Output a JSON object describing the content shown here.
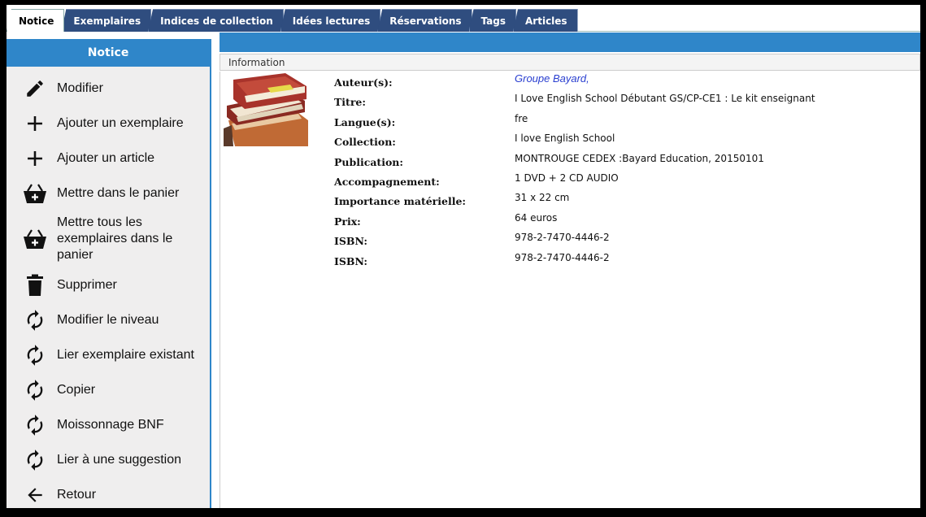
{
  "tabs": [
    {
      "label": "Notice",
      "active": true
    },
    {
      "label": "Exemplaires"
    },
    {
      "label": "Indices de collection"
    },
    {
      "label": "Idées lectures"
    },
    {
      "label": "Réservations"
    },
    {
      "label": "Tags"
    },
    {
      "label": "Articles"
    }
  ],
  "sidebar": {
    "title": "Notice",
    "items": [
      {
        "label": "Modifier",
        "icon": "pencil-icon"
      },
      {
        "label": "Ajouter un exemplaire",
        "icon": "plus-icon"
      },
      {
        "label": "Ajouter un article",
        "icon": "plus-icon"
      },
      {
        "label": "Mettre dans le panier",
        "icon": "basket-add-icon"
      },
      {
        "label": "Mettre tous les exemplaires dans le panier",
        "icon": "basket-add-icon"
      },
      {
        "label": "Supprimer",
        "icon": "trash-icon"
      },
      {
        "label": "Modifier le niveau",
        "icon": "refresh-icon"
      },
      {
        "label": "Lier exemplaire existant",
        "icon": "refresh-icon"
      },
      {
        "label": "Copier",
        "icon": "refresh-icon"
      },
      {
        "label": "Moissonnage BNF",
        "icon": "refresh-icon"
      },
      {
        "label": "Lier à une suggestion",
        "icon": "refresh-icon"
      },
      {
        "label": "Retour",
        "icon": "arrow-left-icon"
      }
    ]
  },
  "info": {
    "heading": "Information",
    "fields": [
      {
        "key": "Auteur(s):",
        "value": "Groupe Bayard,"
      },
      {
        "key": "Titre:",
        "value": "I Love English School Débutant GS/CP-CE1 : Le kit enseignant"
      },
      {
        "key": "Langue(s):",
        "value": "fre"
      },
      {
        "key": "Collection:",
        "value": "I love English School"
      },
      {
        "key": "Publication:",
        "value": "MONTROUGE CEDEX :Bayard Education, 20150101"
      },
      {
        "key": "Accompagnement:",
        "value": "1 DVD + 2 CD AUDIO"
      },
      {
        "key": "Importance matérielle:",
        "value": "31 x 22 cm"
      },
      {
        "key": "Prix:",
        "value": "64 euros"
      },
      {
        "key": "ISBN:",
        "value": "978-2-7470-4446-2"
      },
      {
        "key": "ISBN:",
        "value": "978-2-7470-4446-2"
      }
    ]
  },
  "colors": {
    "accent": "#2f86c9",
    "tab": "#2f4d7f",
    "link": "#2a3fd0"
  }
}
